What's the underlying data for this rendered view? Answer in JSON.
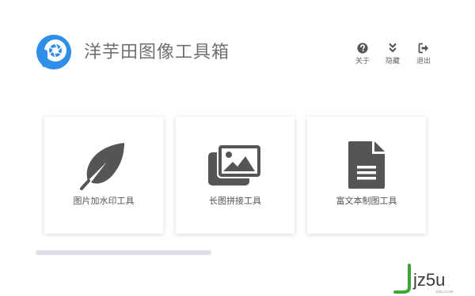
{
  "app": {
    "title": "洋芋田图像工具箱"
  },
  "header_actions": [
    {
      "id": "about",
      "label": "关于",
      "icon": "question-circle-icon"
    },
    {
      "id": "hide",
      "label": "隐藏",
      "icon": "double-chevron-down-icon"
    },
    {
      "id": "exit",
      "label": "退出",
      "icon": "sign-out-icon"
    }
  ],
  "tools": [
    {
      "label": "图片加水印工具",
      "icon": "feather-icon"
    },
    {
      "label": "长图拼接工具",
      "icon": "images-icon"
    },
    {
      "label": "富文本制图工具",
      "icon": "document-icon"
    }
  ],
  "watermark": {
    "brand": "jz5u",
    "domain": "JZ5U.COM"
  },
  "colors": {
    "logo_blue": "#2f8ee8",
    "icon_gray": "#555555",
    "scrollbar": "#dcdfe5",
    "watermark_green": "#3fa535"
  }
}
